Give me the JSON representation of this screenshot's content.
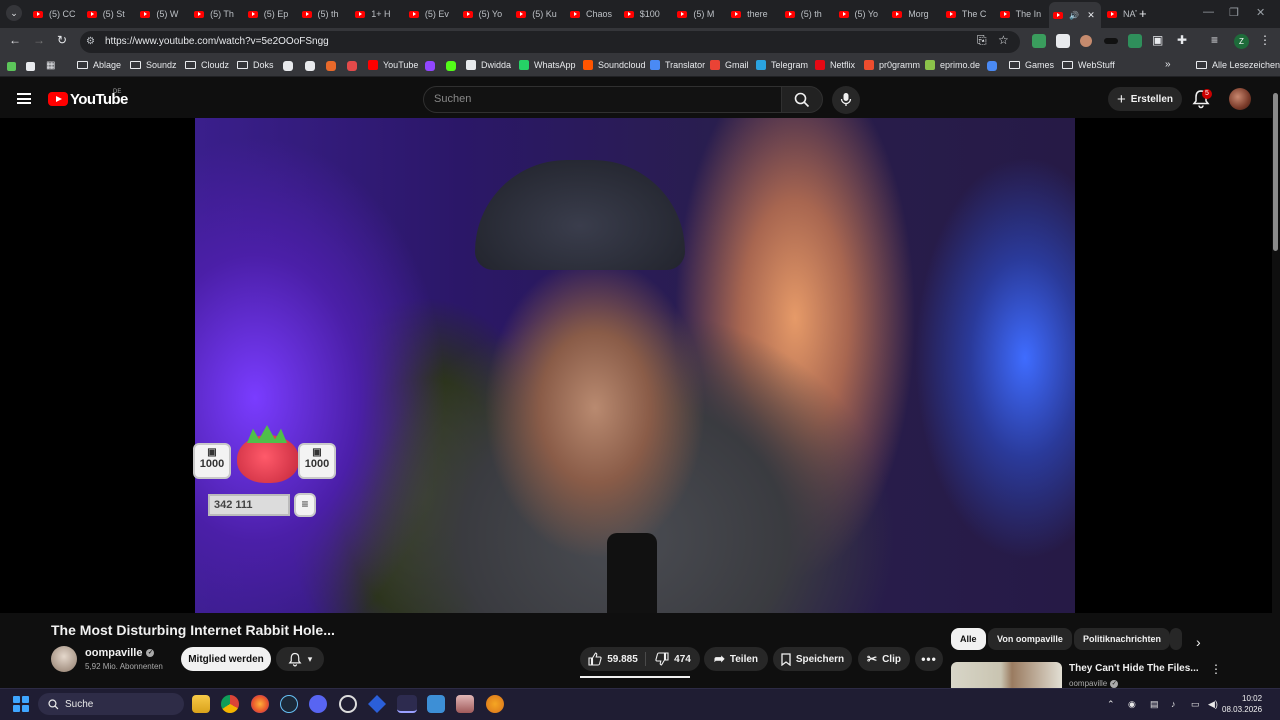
{
  "browser": {
    "tabs": [
      {
        "label": "(5) CC"
      },
      {
        "label": "(5) St"
      },
      {
        "label": "(5) W"
      },
      {
        "label": "(5) Th"
      },
      {
        "label": "(5) Ep"
      },
      {
        "label": "(5) th"
      },
      {
        "label": "1+ H"
      },
      {
        "label": "(5) Ev"
      },
      {
        "label": "(5) Yo"
      },
      {
        "label": "(5) Ku"
      },
      {
        "label": "Chaos"
      },
      {
        "label": "$100"
      },
      {
        "label": "(5) M"
      },
      {
        "label": "there"
      },
      {
        "label": "(5) th"
      },
      {
        "label": "(5) Yo"
      },
      {
        "label": "Morg"
      },
      {
        "label": "The C"
      },
      {
        "label": "The In"
      },
      {
        "label": ""
      },
      {
        "label": "NATO"
      }
    ],
    "new_tab": "+",
    "url": "https://www.youtube.com/watch?v=5e2OOoFSngg",
    "bookmarks": [
      {
        "label": "Ablage",
        "icon": "folder-icon"
      },
      {
        "label": "Soundz",
        "icon": "folder-icon"
      },
      {
        "label": "Cloudz",
        "icon": "folder-icon"
      },
      {
        "label": "Doks",
        "icon": "folder-icon"
      },
      {
        "label": "YouTube",
        "icon": "youtube-icon"
      },
      {
        "label": "Dwidda",
        "icon": "x-icon"
      },
      {
        "label": "WhatsApp",
        "icon": "whatsapp-icon"
      },
      {
        "label": "Soundcloud",
        "icon": "soundcloud-icon"
      },
      {
        "label": "Translator",
        "icon": "translator-icon"
      },
      {
        "label": "Gmail",
        "icon": "gmail-icon"
      },
      {
        "label": "Telegram",
        "icon": "telegram-icon"
      },
      {
        "label": "Netflix",
        "icon": "netflix-icon"
      },
      {
        "label": "pr0gramm",
        "icon": "pr0gramm-icon"
      },
      {
        "label": "eprimo.de",
        "icon": "eprimo-icon"
      },
      {
        "label": "Games",
        "icon": "folder-icon"
      },
      {
        "label": "WebStuff",
        "icon": "folder-icon"
      }
    ],
    "all_bookmarks": "Alle Lesezeichen",
    "profile_initial": "Z"
  },
  "youtube": {
    "logo_text": "YouTube",
    "region": "DE",
    "search_placeholder": "Suchen",
    "create_label": "Erstellen",
    "notification_count": "5",
    "overlay": {
      "left_count": "1000",
      "right_count": "1000",
      "counter": "342 111"
    },
    "video": {
      "title": "The Most Disturbing Internet Rabbit Hole...",
      "channel": "oompaville",
      "subscribers": "5,92 Mio. Abonnenten",
      "join_label": "Mitglied werden",
      "likes": "59.885",
      "dislikes": "474",
      "share_label": "Teilen",
      "save_label": "Speichern",
      "clip_label": "Clip"
    },
    "chips": [
      {
        "label": "Alle",
        "active": true
      },
      {
        "label": "Von oompaville",
        "active": false
      },
      {
        "label": "Politiknachrichten",
        "active": false
      }
    ],
    "recommendation": {
      "title": "They Can't Hide The Files...",
      "channel": "oompaville"
    }
  },
  "taskbar": {
    "search_label": "Suche",
    "time": "10:02",
    "date": "08.03.2026"
  },
  "colors": {
    "brand_red": "#ff0000",
    "background": "#0f0f0f",
    "accent_blue": "#3fa6ff"
  }
}
